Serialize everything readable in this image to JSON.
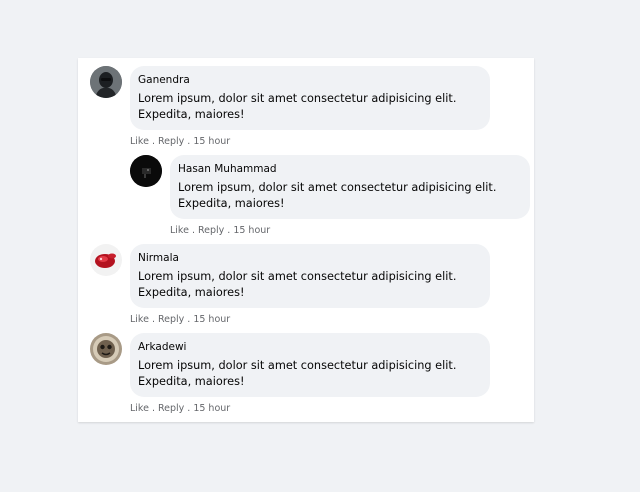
{
  "comments": [
    {
      "author": "Ganendra",
      "text": "Lorem ipsum, dolor sit amet consectetur adipisicing elit. Expedita, maiores!",
      "like_label": "Like",
      "reply_label": "Reply",
      "separator": ".",
      "time": "15 hour",
      "avatar_icon": "dark-figure-avatar"
    },
    {
      "author": "Hasan Muhammad",
      "text": "Lorem ipsum, dolor sit amet consectetur adipisicing elit. Expedita, maiores!",
      "like_label": "Like",
      "reply_label": "Reply",
      "separator": ".",
      "time": "15 hour",
      "avatar_icon": "black-night-avatar"
    },
    {
      "author": "Nirmala",
      "text": "Lorem ipsum, dolor sit amet consectetur adipisicing elit. Expedita, maiores!",
      "like_label": "Like",
      "reply_label": "Reply",
      "separator": ".",
      "time": "15 hour",
      "avatar_icon": "red-ring-avatar"
    },
    {
      "author": "Arkadewi",
      "text": "Lorem ipsum, dolor sit amet consectetur adipisicing elit. Expedita, maiores!",
      "like_label": "Like",
      "reply_label": "Reply",
      "separator": ".",
      "time": "15 hour",
      "avatar_icon": "ornament-avatar"
    }
  ],
  "colors": {
    "page_bg": "#f0f2f5",
    "card_bg": "#ffffff",
    "bubble_bg": "#f0f2f5",
    "meta_text": "#65676b"
  }
}
